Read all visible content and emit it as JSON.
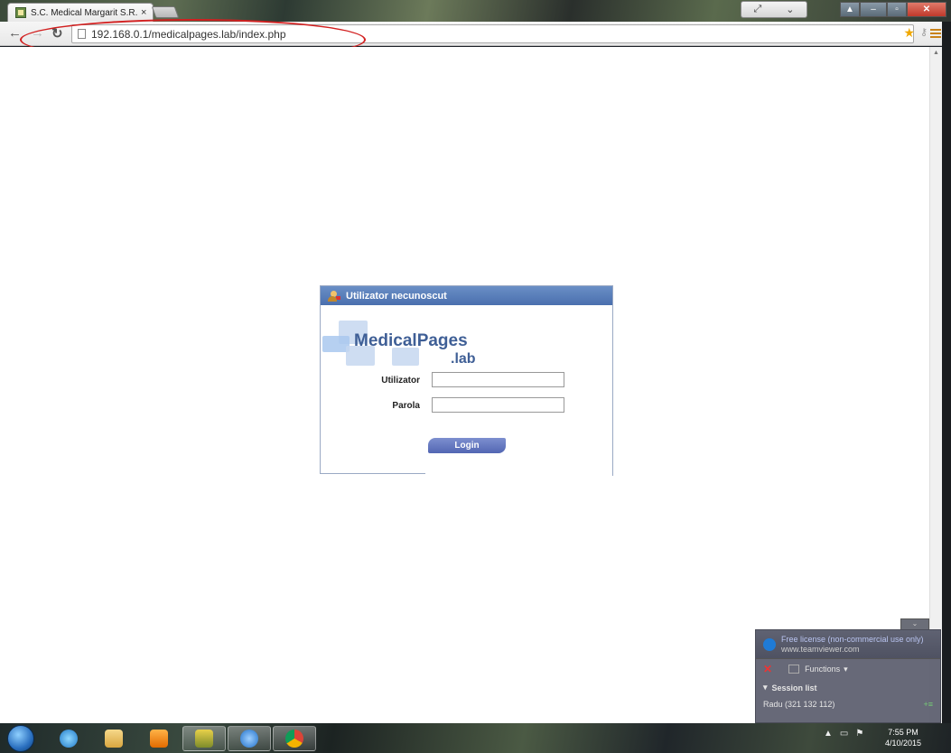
{
  "browser": {
    "tab_title": "S.C. Medical Margarit S.R.",
    "tab_close": "×",
    "url": "192.168.0.1/medicalpages.lab/index.php"
  },
  "login": {
    "header": "Utilizator necunoscut",
    "logo_line1": "MedicalPages",
    "logo_line2": ".lab",
    "user_label": "Utilizator",
    "user_value": "",
    "password_label": "Parola",
    "password_value": "",
    "login_button": "Login"
  },
  "teamviewer": {
    "title": "Free license (non-commercial use only)",
    "subtitle": "www.teamviewer.com",
    "functions": "Functions",
    "session_list": "Session list",
    "session_entry": "Radu (321 132 112)"
  },
  "taskbar": {
    "time": "7:55 PM",
    "date": "4/10/2015"
  },
  "colors": {
    "panel_header": "#4a6fae",
    "logo_text": "#3f5f96",
    "login_button": "#5266b3",
    "annotation": "#d21f1f"
  }
}
